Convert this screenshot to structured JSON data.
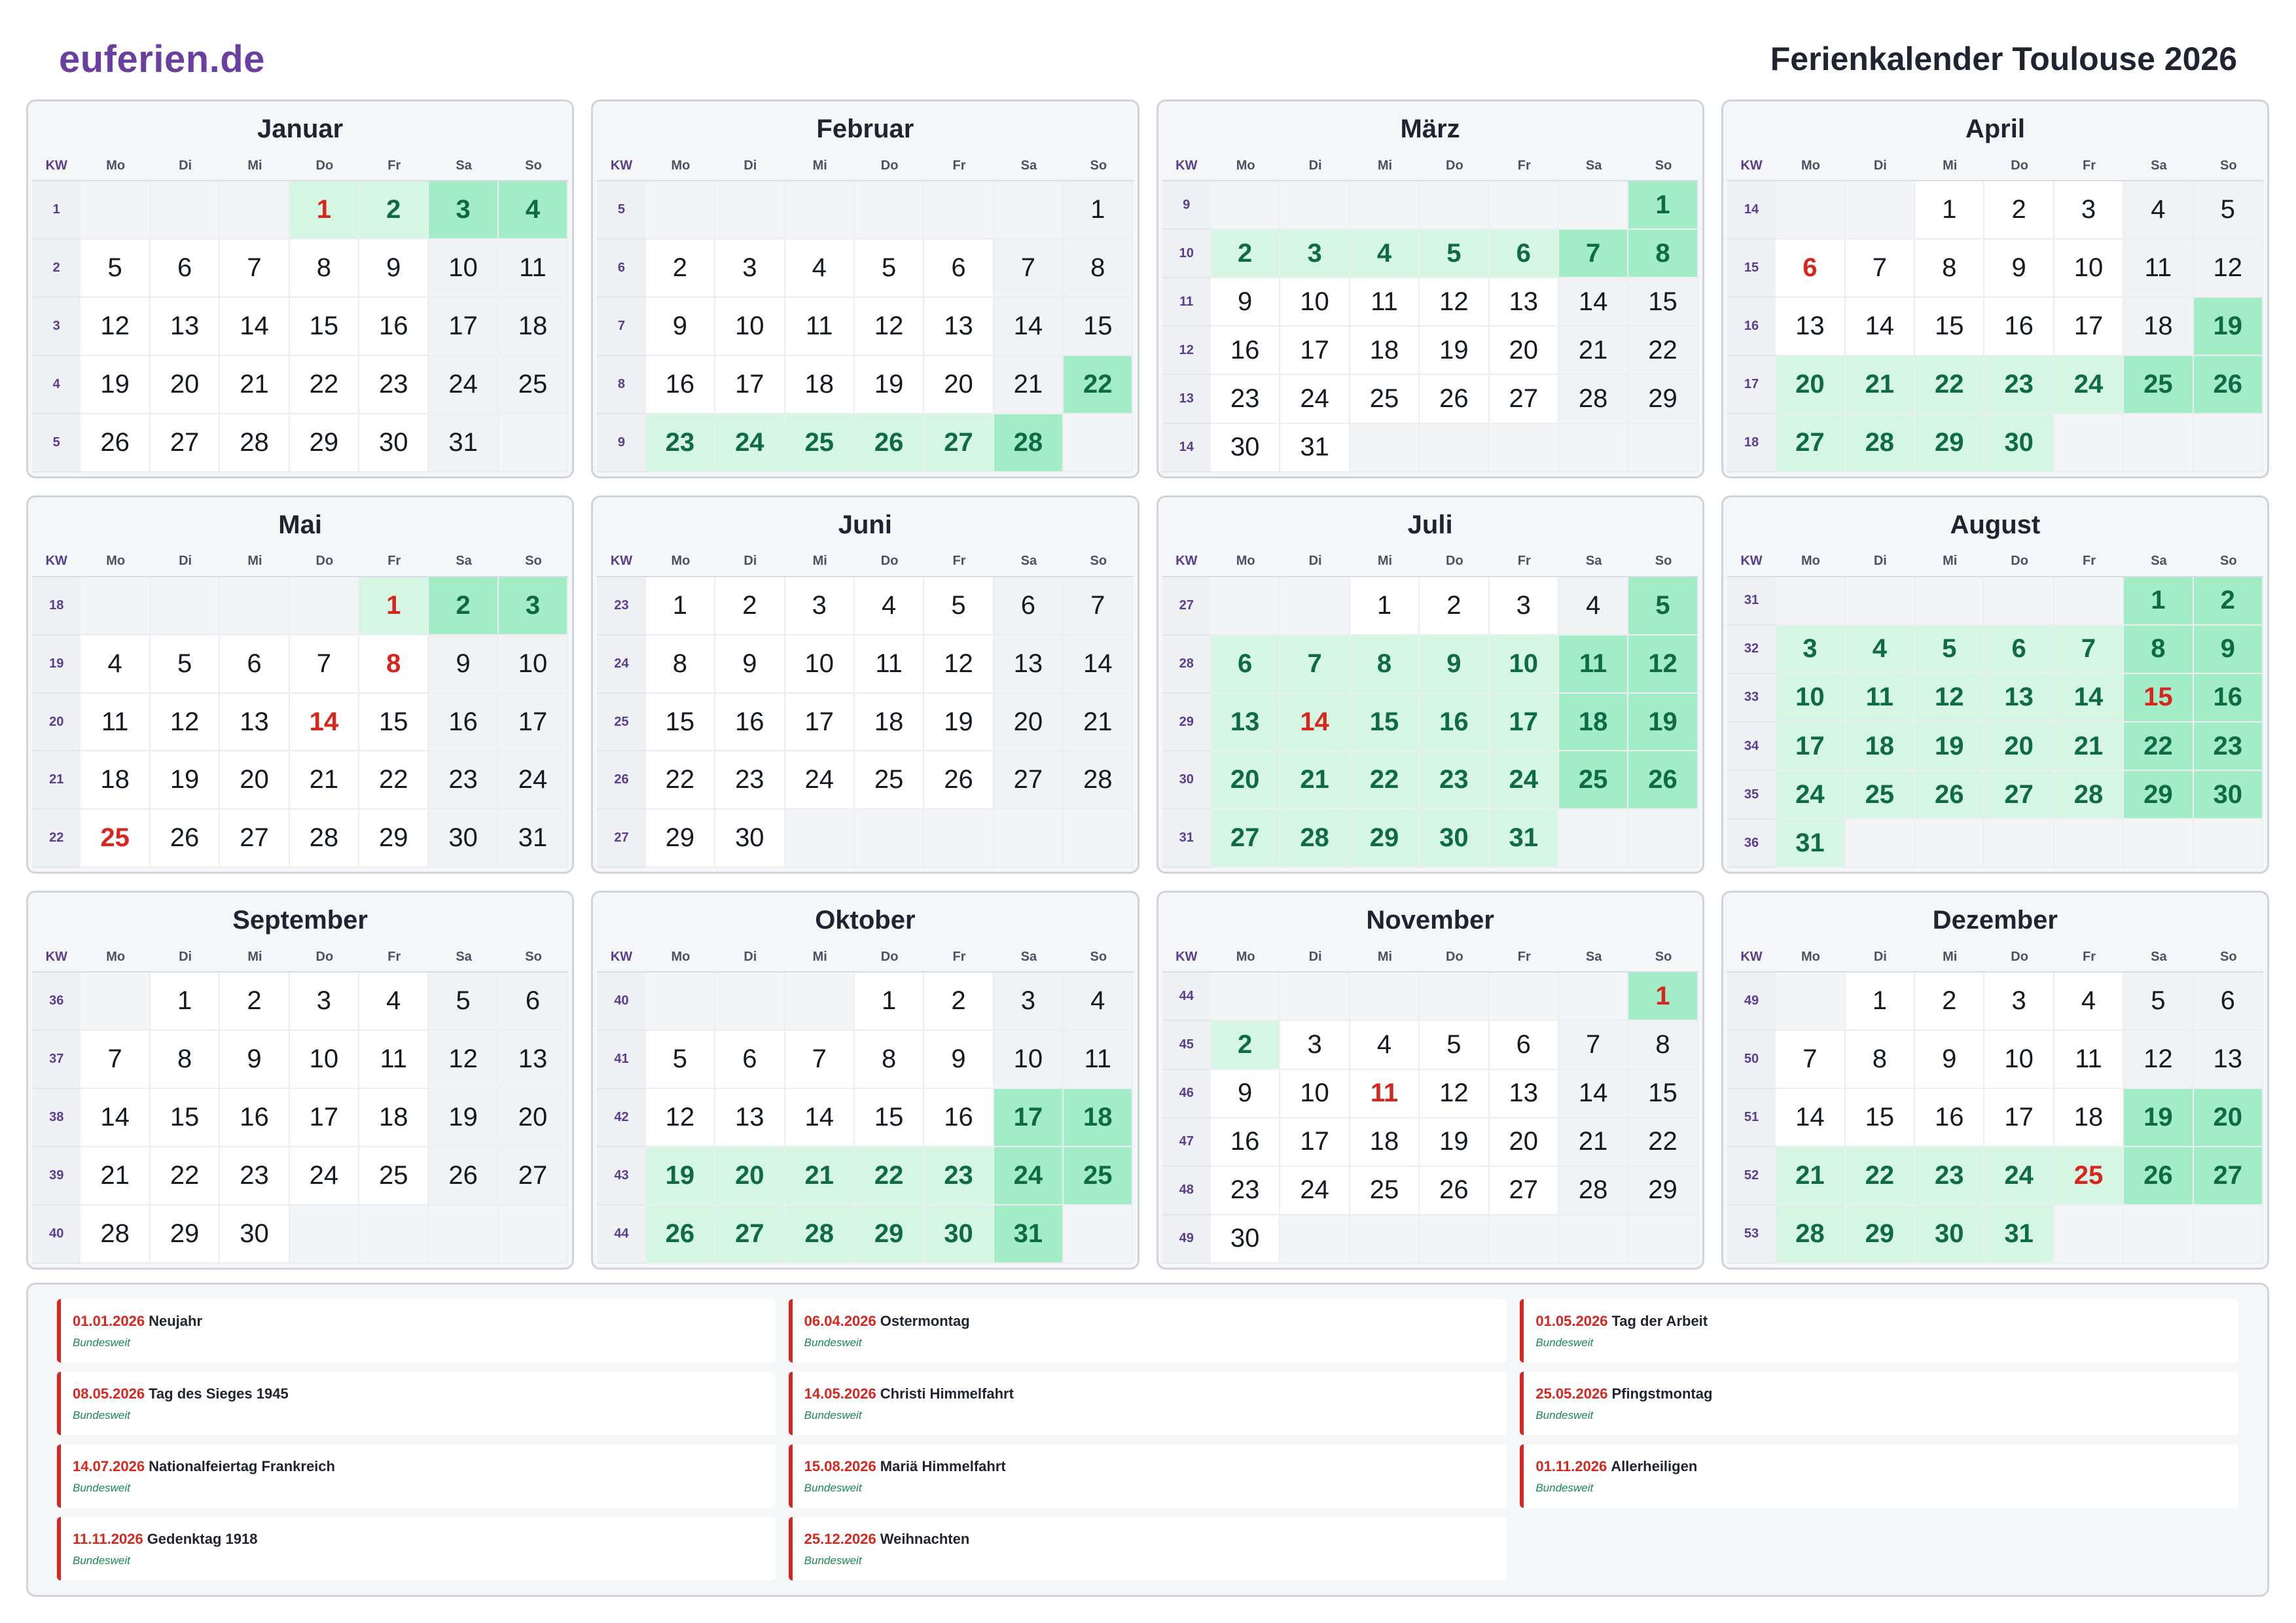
{
  "header": {
    "brand": "euferien.de",
    "title": "Ferienkalender Toulouse 2026"
  },
  "colors": {
    "brand": "#6a3fa0",
    "holiday": "#d7261e",
    "vacation": "#d4f6e3",
    "vacation_weekend": "#a3ecc8",
    "vacation_text": "#0f6b46",
    "scope_text": "#198a4f"
  },
  "kw_label": "KW",
  "weekdays": [
    "Mo",
    "Di",
    "Mi",
    "Do",
    "Fr",
    "Sa",
    "So"
  ],
  "months": [
    {
      "name": "Januar",
      "weeks": [
        {
          "kw": "1",
          "days": [
            "",
            "",
            "",
            "1",
            "2",
            "3",
            "4"
          ]
        },
        {
          "kw": "2",
          "days": [
            "5",
            "6",
            "7",
            "8",
            "9",
            "10",
            "11"
          ]
        },
        {
          "kw": "3",
          "days": [
            "12",
            "13",
            "14",
            "15",
            "16",
            "17",
            "18"
          ]
        },
        {
          "kw": "4",
          "days": [
            "19",
            "20",
            "21",
            "22",
            "23",
            "24",
            "25"
          ]
        },
        {
          "kw": "5",
          "days": [
            "26",
            "27",
            "28",
            "29",
            "30",
            "31",
            ""
          ]
        }
      ],
      "holidays": [
        "1"
      ],
      "vacation": [
        "1",
        "2",
        "3",
        "4"
      ]
    },
    {
      "name": "Februar",
      "weeks": [
        {
          "kw": "5",
          "days": [
            "",
            "",
            "",
            "",
            "",
            "",
            "1"
          ]
        },
        {
          "kw": "6",
          "days": [
            "2",
            "3",
            "4",
            "5",
            "6",
            "7",
            "8"
          ]
        },
        {
          "kw": "7",
          "days": [
            "9",
            "10",
            "11",
            "12",
            "13",
            "14",
            "15"
          ]
        },
        {
          "kw": "8",
          "days": [
            "16",
            "17",
            "18",
            "19",
            "20",
            "21",
            "22"
          ]
        },
        {
          "kw": "9",
          "days": [
            "23",
            "24",
            "25",
            "26",
            "27",
            "28",
            ""
          ]
        }
      ],
      "holidays": [],
      "vacation": [
        "22",
        "23",
        "24",
        "25",
        "26",
        "27",
        "28"
      ]
    },
    {
      "name": "März",
      "weeks": [
        {
          "kw": "9",
          "days": [
            "",
            "",
            "",
            "",
            "",
            "",
            "1"
          ]
        },
        {
          "kw": "10",
          "days": [
            "2",
            "3",
            "4",
            "5",
            "6",
            "7",
            "8"
          ]
        },
        {
          "kw": "11",
          "days": [
            "9",
            "10",
            "11",
            "12",
            "13",
            "14",
            "15"
          ]
        },
        {
          "kw": "12",
          "days": [
            "16",
            "17",
            "18",
            "19",
            "20",
            "21",
            "22"
          ]
        },
        {
          "kw": "13",
          "days": [
            "23",
            "24",
            "25",
            "26",
            "27",
            "28",
            "29"
          ]
        },
        {
          "kw": "14",
          "days": [
            "30",
            "31",
            "",
            "",
            "",
            "",
            ""
          ]
        }
      ],
      "holidays": [],
      "vacation": [
        "1",
        "2",
        "3",
        "4",
        "5",
        "6",
        "7",
        "8"
      ]
    },
    {
      "name": "April",
      "weeks": [
        {
          "kw": "14",
          "days": [
            "",
            "",
            "1",
            "2",
            "3",
            "4",
            "5"
          ]
        },
        {
          "kw": "15",
          "days": [
            "6",
            "7",
            "8",
            "9",
            "10",
            "11",
            "12"
          ]
        },
        {
          "kw": "16",
          "days": [
            "13",
            "14",
            "15",
            "16",
            "17",
            "18",
            "19"
          ]
        },
        {
          "kw": "17",
          "days": [
            "20",
            "21",
            "22",
            "23",
            "24",
            "25",
            "26"
          ]
        },
        {
          "kw": "18",
          "days": [
            "27",
            "28",
            "29",
            "30",
            "",
            "",
            ""
          ]
        }
      ],
      "holidays": [
        "6"
      ],
      "vacation": [
        "19",
        "20",
        "21",
        "22",
        "23",
        "24",
        "25",
        "26",
        "27",
        "28",
        "29",
        "30"
      ]
    },
    {
      "name": "Mai",
      "weeks": [
        {
          "kw": "18",
          "days": [
            "",
            "",
            "",
            "",
            "1",
            "2",
            "3"
          ]
        },
        {
          "kw": "19",
          "days": [
            "4",
            "5",
            "6",
            "7",
            "8",
            "9",
            "10"
          ]
        },
        {
          "kw": "20",
          "days": [
            "11",
            "12",
            "13",
            "14",
            "15",
            "16",
            "17"
          ]
        },
        {
          "kw": "21",
          "days": [
            "18",
            "19",
            "20",
            "21",
            "22",
            "23",
            "24"
          ]
        },
        {
          "kw": "22",
          "days": [
            "25",
            "26",
            "27",
            "28",
            "29",
            "30",
            "31"
          ]
        }
      ],
      "holidays": [
        "1",
        "8",
        "14",
        "25"
      ],
      "vacation": [
        "1",
        "2",
        "3"
      ]
    },
    {
      "name": "Juni",
      "weeks": [
        {
          "kw": "23",
          "days": [
            "1",
            "2",
            "3",
            "4",
            "5",
            "6",
            "7"
          ]
        },
        {
          "kw": "24",
          "days": [
            "8",
            "9",
            "10",
            "11",
            "12",
            "13",
            "14"
          ]
        },
        {
          "kw": "25",
          "days": [
            "15",
            "16",
            "17",
            "18",
            "19",
            "20",
            "21"
          ]
        },
        {
          "kw": "26",
          "days": [
            "22",
            "23",
            "24",
            "25",
            "26",
            "27",
            "28"
          ]
        },
        {
          "kw": "27",
          "days": [
            "29",
            "30",
            "",
            "",
            "",
            "",
            ""
          ]
        }
      ],
      "holidays": [],
      "vacation": []
    },
    {
      "name": "Juli",
      "weeks": [
        {
          "kw": "27",
          "days": [
            "",
            "",
            "1",
            "2",
            "3",
            "4",
            "5"
          ]
        },
        {
          "kw": "28",
          "days": [
            "6",
            "7",
            "8",
            "9",
            "10",
            "11",
            "12"
          ]
        },
        {
          "kw": "29",
          "days": [
            "13",
            "14",
            "15",
            "16",
            "17",
            "18",
            "19"
          ]
        },
        {
          "kw": "30",
          "days": [
            "20",
            "21",
            "22",
            "23",
            "24",
            "25",
            "26"
          ]
        },
        {
          "kw": "31",
          "days": [
            "27",
            "28",
            "29",
            "30",
            "31",
            "",
            ""
          ]
        }
      ],
      "holidays": [
        "14"
      ],
      "vacation": [
        "5",
        "6",
        "7",
        "8",
        "9",
        "10",
        "11",
        "12",
        "13",
        "14",
        "15",
        "16",
        "17",
        "18",
        "19",
        "20",
        "21",
        "22",
        "23",
        "24",
        "25",
        "26",
        "27",
        "28",
        "29",
        "30",
        "31"
      ]
    },
    {
      "name": "August",
      "weeks": [
        {
          "kw": "31",
          "days": [
            "",
            "",
            "",
            "",
            "",
            "1",
            "2"
          ]
        },
        {
          "kw": "32",
          "days": [
            "3",
            "4",
            "5",
            "6",
            "7",
            "8",
            "9"
          ]
        },
        {
          "kw": "33",
          "days": [
            "10",
            "11",
            "12",
            "13",
            "14",
            "15",
            "16"
          ]
        },
        {
          "kw": "34",
          "days": [
            "17",
            "18",
            "19",
            "20",
            "21",
            "22",
            "23"
          ]
        },
        {
          "kw": "35",
          "days": [
            "24",
            "25",
            "26",
            "27",
            "28",
            "29",
            "30"
          ]
        },
        {
          "kw": "36",
          "days": [
            "31",
            "",
            "",
            "",
            "",
            "",
            ""
          ]
        }
      ],
      "holidays": [
        "15"
      ],
      "vacation": [
        "1",
        "2",
        "3",
        "4",
        "5",
        "6",
        "7",
        "8",
        "9",
        "10",
        "11",
        "12",
        "13",
        "14",
        "15",
        "16",
        "17",
        "18",
        "19",
        "20",
        "21",
        "22",
        "23",
        "24",
        "25",
        "26",
        "27",
        "28",
        "29",
        "30",
        "31"
      ]
    },
    {
      "name": "September",
      "weeks": [
        {
          "kw": "36",
          "days": [
            "",
            "1",
            "2",
            "3",
            "4",
            "5",
            "6"
          ]
        },
        {
          "kw": "37",
          "days": [
            "7",
            "8",
            "9",
            "10",
            "11",
            "12",
            "13"
          ]
        },
        {
          "kw": "38",
          "days": [
            "14",
            "15",
            "16",
            "17",
            "18",
            "19",
            "20"
          ]
        },
        {
          "kw": "39",
          "days": [
            "21",
            "22",
            "23",
            "24",
            "25",
            "26",
            "27"
          ]
        },
        {
          "kw": "40",
          "days": [
            "28",
            "29",
            "30",
            "",
            "",
            "",
            ""
          ]
        }
      ],
      "holidays": [],
      "vacation": []
    },
    {
      "name": "Oktober",
      "weeks": [
        {
          "kw": "40",
          "days": [
            "",
            "",
            "",
            "1",
            "2",
            "3",
            "4"
          ]
        },
        {
          "kw": "41",
          "days": [
            "5",
            "6",
            "7",
            "8",
            "9",
            "10",
            "11"
          ]
        },
        {
          "kw": "42",
          "days": [
            "12",
            "13",
            "14",
            "15",
            "16",
            "17",
            "18"
          ]
        },
        {
          "kw": "43",
          "days": [
            "19",
            "20",
            "21",
            "22",
            "23",
            "24",
            "25"
          ]
        },
        {
          "kw": "44",
          "days": [
            "26",
            "27",
            "28",
            "29",
            "30",
            "31",
            ""
          ]
        }
      ],
      "holidays": [],
      "vacation": [
        "17",
        "18",
        "19",
        "20",
        "21",
        "22",
        "23",
        "24",
        "25",
        "26",
        "27",
        "28",
        "29",
        "30",
        "31"
      ]
    },
    {
      "name": "November",
      "weeks": [
        {
          "kw": "44",
          "days": [
            "",
            "",
            "",
            "",
            "",
            "",
            "1"
          ]
        },
        {
          "kw": "45",
          "days": [
            "2",
            "3",
            "4",
            "5",
            "6",
            "7",
            "8"
          ]
        },
        {
          "kw": "46",
          "days": [
            "9",
            "10",
            "11",
            "12",
            "13",
            "14",
            "15"
          ]
        },
        {
          "kw": "47",
          "days": [
            "16",
            "17",
            "18",
            "19",
            "20",
            "21",
            "22"
          ]
        },
        {
          "kw": "48",
          "days": [
            "23",
            "24",
            "25",
            "26",
            "27",
            "28",
            "29"
          ]
        },
        {
          "kw": "49",
          "days": [
            "30",
            "",
            "",
            "",
            "",
            "",
            ""
          ]
        }
      ],
      "holidays": [
        "1",
        "11"
      ],
      "vacation": [
        "1",
        "2"
      ]
    },
    {
      "name": "Dezember",
      "weeks": [
        {
          "kw": "49",
          "days": [
            "",
            "1",
            "2",
            "3",
            "4",
            "5",
            "6"
          ]
        },
        {
          "kw": "50",
          "days": [
            "7",
            "8",
            "9",
            "10",
            "11",
            "12",
            "13"
          ]
        },
        {
          "kw": "51",
          "days": [
            "14",
            "15",
            "16",
            "17",
            "18",
            "19",
            "20"
          ]
        },
        {
          "kw": "52",
          "days": [
            "21",
            "22",
            "23",
            "24",
            "25",
            "26",
            "27"
          ]
        },
        {
          "kw": "53",
          "days": [
            "28",
            "29",
            "30",
            "31",
            "",
            "",
            ""
          ]
        }
      ],
      "holidays": [
        "25"
      ],
      "vacation": [
        "19",
        "20",
        "21",
        "22",
        "23",
        "24",
        "25",
        "26",
        "27",
        "28",
        "29",
        "30",
        "31"
      ]
    }
  ],
  "holidays_legend": [
    {
      "date": "01.01.2026",
      "name": "Neujahr",
      "scope": "Bundesweit"
    },
    {
      "date": "06.04.2026",
      "name": "Ostermontag",
      "scope": "Bundesweit"
    },
    {
      "date": "01.05.2026",
      "name": "Tag der Arbeit",
      "scope": "Bundesweit"
    },
    {
      "date": "08.05.2026",
      "name": "Tag des Sieges 1945",
      "scope": "Bundesweit"
    },
    {
      "date": "14.05.2026",
      "name": "Christi Himmelfahrt",
      "scope": "Bundesweit"
    },
    {
      "date": "25.05.2026",
      "name": "Pfingstmontag",
      "scope": "Bundesweit"
    },
    {
      "date": "14.07.2026",
      "name": "Nationalfeiertag Frankreich",
      "scope": "Bundesweit"
    },
    {
      "date": "15.08.2026",
      "name": "Mariä Himmelfahrt",
      "scope": "Bundesweit"
    },
    {
      "date": "01.11.2026",
      "name": "Allerheiligen",
      "scope": "Bundesweit"
    },
    {
      "date": "11.11.2026",
      "name": "Gedenktag 1918",
      "scope": "Bundesweit"
    },
    {
      "date": "25.12.2026",
      "name": "Weihnachten",
      "scope": "Bundesweit"
    }
  ]
}
